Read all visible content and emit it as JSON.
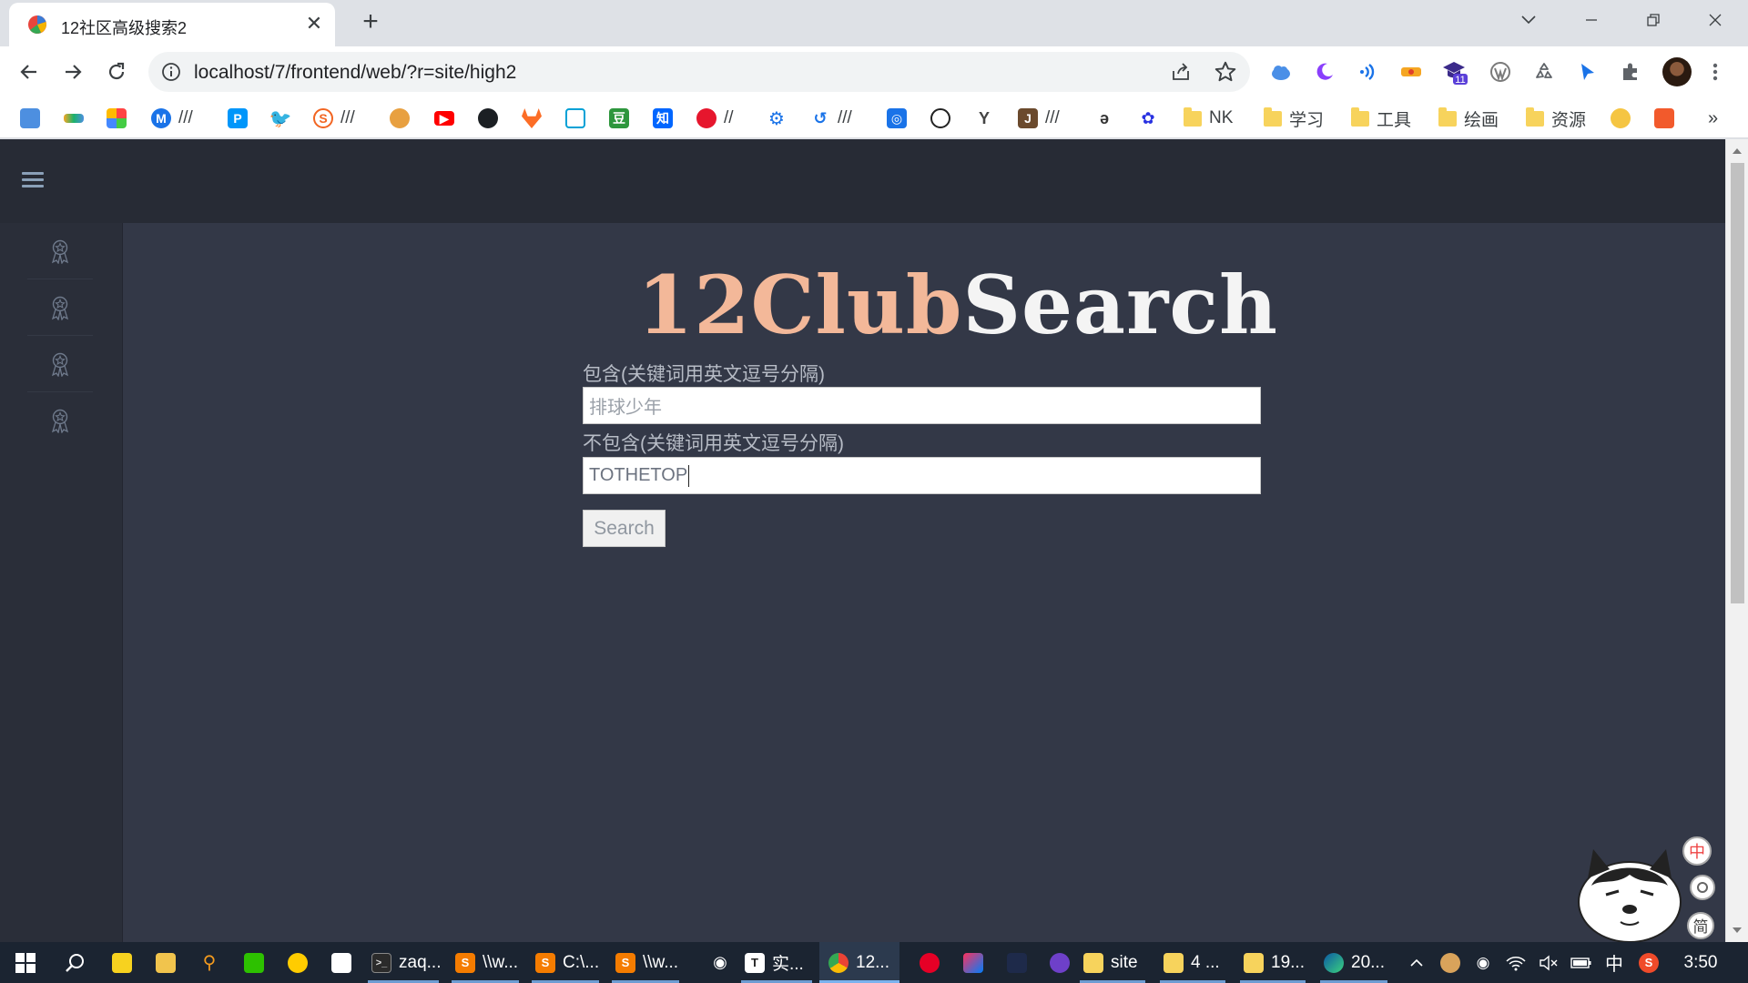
{
  "browser": {
    "tab_title": "12社区高级搜索2",
    "url": "localhost/7/frontend/web/?r=site/high2"
  },
  "bookmarks": {
    "sep1": "///",
    "sep2": "///",
    "sep3": "//",
    "sep4": "///",
    "sep5": "///",
    "j_label": "J",
    "folders": [
      "NK",
      "学习",
      "工具",
      "绘画",
      "资源"
    ],
    "more": "»"
  },
  "extensions": {
    "badge": "11"
  },
  "page": {
    "logo_part1": "12Club",
    "logo_part2": "Search",
    "include_label": "包含(关键词用英文逗号分隔)",
    "include_placeholder": "排球少年",
    "exclude_label": "不包含(关键词用英文逗号分隔)",
    "exclude_value": "TOTHETOP",
    "search_button": "Search"
  },
  "mascot": {
    "badges": [
      "中",
      "简"
    ]
  },
  "taskbar": {
    "items": [
      "zaq...",
      "\\\\w...",
      "C:\\...",
      "\\\\w...",
      "实...",
      "12...",
      "site",
      "4 ...",
      "19...",
      "20..."
    ],
    "t_icon": "T",
    "ime": "中",
    "sogou": "S",
    "clock": "3:50"
  }
}
